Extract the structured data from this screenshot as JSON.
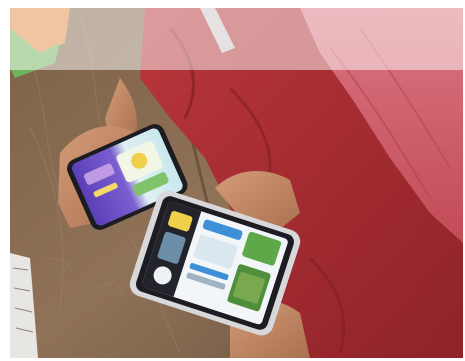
{
  "scene": {
    "colors": {
      "desk_wood": "#8b6d52",
      "desk_wood_dark": "#5e4634",
      "uniform_red": "#b8353a",
      "uniform_red_dark": "#8f2228",
      "hijab_pink": "#d96b74",
      "skin": "#c98f6d",
      "phone_body": "#1c1c22",
      "phone_frame_silver": "#d8d8da",
      "screen_purple": "#6a4fc4",
      "screen_light": "#eaf3f5",
      "screen_blue": "#3d8fd8",
      "screen_green": "#5fa84a",
      "screen_yellow": "#f0d04a",
      "wall_orange": "#e98a4a",
      "book_green": "#6fb35a"
    },
    "objects": [
      "wooden-desk",
      "red-uniform-student",
      "pink-hijab",
      "smartphone-left",
      "smartphone-right",
      "hand-holding-phone"
    ]
  }
}
